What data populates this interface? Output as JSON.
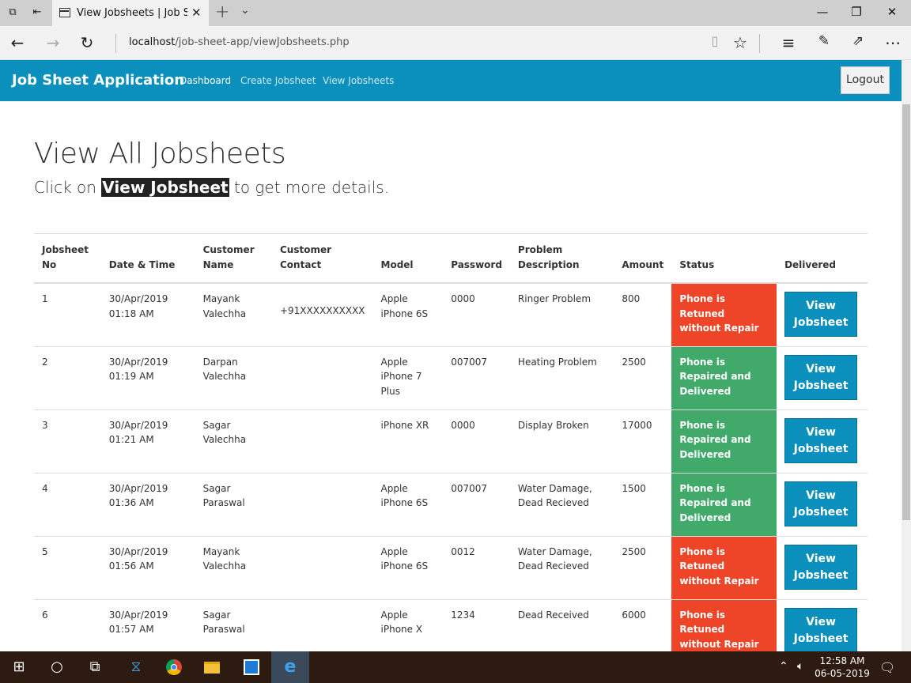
{
  "browser": {
    "tab_title": "View Jobsheets | Job Sh",
    "url_host": "localhost",
    "url_path": "/job-sheet-app/viewJobsheets.php"
  },
  "app": {
    "brand": "Job Sheet Application",
    "nav": [
      "Dashboard",
      "Create Jobsheet",
      "View Jobsheets"
    ],
    "logout_label": "Logout"
  },
  "heading": "View All Jobsheets",
  "lead": {
    "before": "Click on ",
    "highlight": "View Jobsheet",
    "after": " to get more details."
  },
  "table": {
    "headers": [
      "Jobsheet No",
      "Date & Time",
      "Customer Name",
      "Customer Contact",
      "Model",
      "Password",
      "Problem Description",
      "Amount",
      "Status",
      "Delivered"
    ],
    "rows": [
      {
        "no": "1",
        "date": "30/Apr/2019",
        "time": "01:18 AM",
        "name1": "Mayank",
        "name2": "Valechha",
        "contact": "+91XXXXXXXXXX",
        "model": "Apple iPhone 6S",
        "password": "0000",
        "problem": "Ringer Problem",
        "amount": "800",
        "status": "Phone is Retuned without Repair",
        "status_color": "#ee4427",
        "button": "View Jobsheet"
      },
      {
        "no": "2",
        "date": "30/Apr/2019",
        "time": "01:19 AM",
        "name1": "Darpan",
        "name2": "Valechha",
        "contact": "",
        "model": "Apple iPhone 7 Plus",
        "password": "007007",
        "problem": "Heating Problem",
        "amount": "2500",
        "status": "Phone is Repaired and Delivered",
        "status_color": "#41aa6a",
        "button": "View Jobsheet"
      },
      {
        "no": "3",
        "date": "30/Apr/2019",
        "time": "01:21 AM",
        "name1": "Sagar",
        "name2": "Valechha",
        "contact": "",
        "model": "iPhone XR",
        "password": "0000",
        "problem": "Display Broken",
        "amount": "17000",
        "status": "Phone is Repaired and Delivered",
        "status_color": "#41aa6a",
        "button": "View Jobsheet"
      },
      {
        "no": "4",
        "date": "30/Apr/2019",
        "time": "01:36 AM",
        "name1": "Sagar",
        "name2": "Paraswal",
        "contact": "",
        "model": "Apple iPhone 6S",
        "password": "007007",
        "problem": "Water Damage, Dead Recieved",
        "amount": "1500",
        "status": "Phone is Repaired and Delivered",
        "status_color": "#41aa6a",
        "button": "View Jobsheet"
      },
      {
        "no": "5",
        "date": "30/Apr/2019",
        "time": "01:56 AM",
        "name1": "Mayank",
        "name2": "Valechha",
        "contact": "",
        "model": "Apple iPhone 6S",
        "password": "0012",
        "problem": "Water Damage, Dead Recieved",
        "amount": "2500",
        "status": "Phone is Retuned without Repair",
        "status_color": "#ee4427",
        "button": "View Jobsheet"
      },
      {
        "no": "6",
        "date": "30/Apr/2019",
        "time": "01:57 AM",
        "name1": "Sagar",
        "name2": "Paraswal",
        "contact": "",
        "model": "Apple iPhone X",
        "password": "1234",
        "problem": "Dead Received",
        "amount": "6000",
        "status": "Phone is Retuned without Repair",
        "status_color": "#ee4427",
        "button": "View Jobsheet"
      }
    ]
  },
  "taskbar": {
    "time": "12:58 AM",
    "date": "06-05-2019"
  },
  "colors": {
    "appbar": "#0b8fbd",
    "status_red": "#ee4427",
    "status_green": "#41aa6a"
  }
}
